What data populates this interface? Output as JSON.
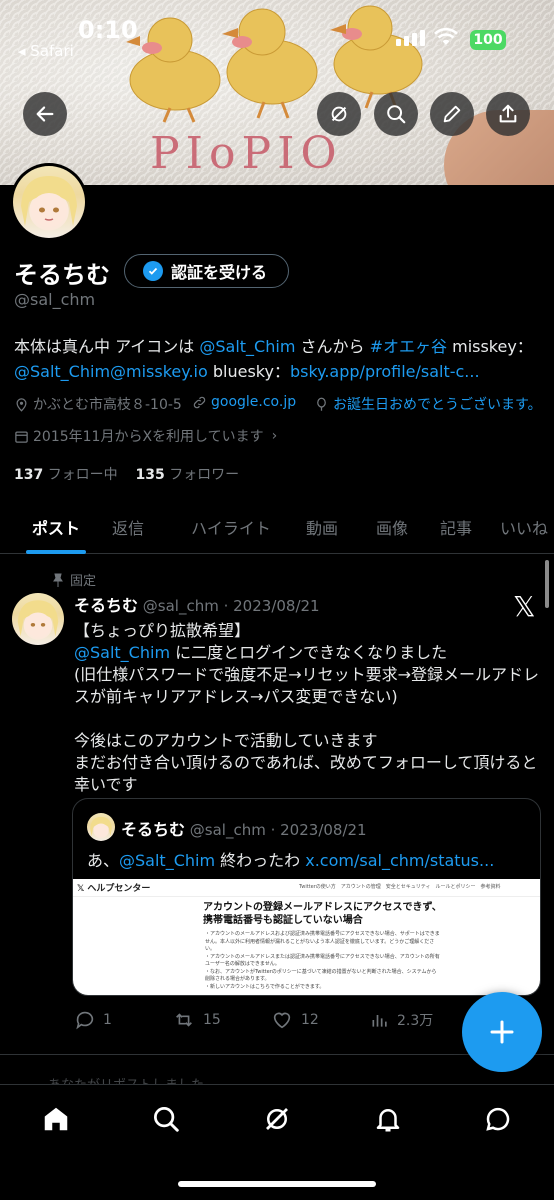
{
  "status_bar": {
    "time": "0:10",
    "back_app": "◂ Safari",
    "battery": "100"
  },
  "banner": {
    "embroidery_text": "PIoPIO"
  },
  "profile": {
    "name": "そるちむ",
    "verify_button": "認証を受ける",
    "handle": "@sal_chm",
    "bio": {
      "t1": "本体は真ん中 アイコンは ",
      "mention1": "@Salt_Chim",
      "t2": " さんから ",
      "hashtag": "#オエヶ谷",
      "t3": " misskey：",
      "misskey_link": "@Salt_Chim@misskey.io",
      "t4": " bluesky：",
      "bluesky_link": "bsky.app/profile/salt-c..."
    },
    "location": "かぶとむ市高枝８-10-5",
    "website": "google.co.jp",
    "birthday": "お誕生日おめでとうございます。",
    "joined": "2015年11月からXを利用しています",
    "following_count": "137",
    "following_label": "フォロー中",
    "followers_count": "135",
    "followers_label": "フォロワー"
  },
  "tabs": [
    "ポスト",
    "返信",
    "ハイライト",
    "動画",
    "画像",
    "記事",
    "いいね"
  ],
  "active_tab": "ポスト",
  "post": {
    "pinned_label": "固定",
    "author": "そるちむ",
    "handle_date": "@sal_chm · 2023/08/21",
    "line1": "【ちょっぴり拡散希望】",
    "mention": "@Salt_Chim",
    "line2": " に二度とログインできなくなりました",
    "line3": "(旧仕様パスワードで強度不足→リセット要求→登録メールアドレスが前キャリアアドレス→パス変更できない)",
    "line4": "今後はこのアカウントで活動していきます",
    "line5": "まだお付き合い頂けるのであれば、改めてフォローして頂けると幸いです",
    "quote": {
      "author": "そるちむ",
      "handle_date": "@sal_chm · 2023/08/21",
      "t1": "あ、",
      "mention": "@Salt_Chim",
      "t2": " 終わったわ ",
      "link": "x.com/sal_chm/status...",
      "image": {
        "brand": "𝕏 ヘルプセンター",
        "nav": "Twitterの使い方　アカウントの管理　安全とセキュリティ　ルールとポリシー　参考資料",
        "title": "アカウントの登録メールアドレスにアクセスできず、携帯電話番号も認証していない場合",
        "bullets": [
          "・アカウントのメールアドレスおよび認証済み携帯電話番号にアクセスできない場合、サポートはできません。本人以外に利用者情報が漏れることがないよう本人認証を徹底しています。どうかご理解ください。",
          "・アカウントのメールアドレスまたは認証済み携帯電話番号にアクセスできない場合、アカウントの所有ユーザー名の解放はできません。",
          "・なお、アカウントがTwitterのポリシーに基づいて凍結の措置がないと判断された場合、システムから削除される場合があります。",
          "・新しいアカウントはこちらで作ることができます。"
        ]
      }
    },
    "replies": "1",
    "reposts": "15",
    "likes": "12",
    "views": "2.3万",
    "next_peek": "あなたがリポストしました"
  },
  "colors": {
    "accent": "#1d9bf0",
    "background": "#000000",
    "muted": "#71767b",
    "text": "#e7e9ea"
  },
  "icons": [
    "back-arrow-icon",
    "grok-icon",
    "search-icon",
    "edit-icon",
    "share-icon",
    "verified-badge-icon",
    "location-icon",
    "link-icon",
    "balloon-icon",
    "calendar-icon",
    "pin-icon",
    "x-logo-icon",
    "reply-icon",
    "repost-icon",
    "like-icon",
    "views-icon",
    "compose-plus-icon",
    "home-icon",
    "explore-icon",
    "grok-nav-icon",
    "notifications-icon",
    "messages-icon"
  ]
}
